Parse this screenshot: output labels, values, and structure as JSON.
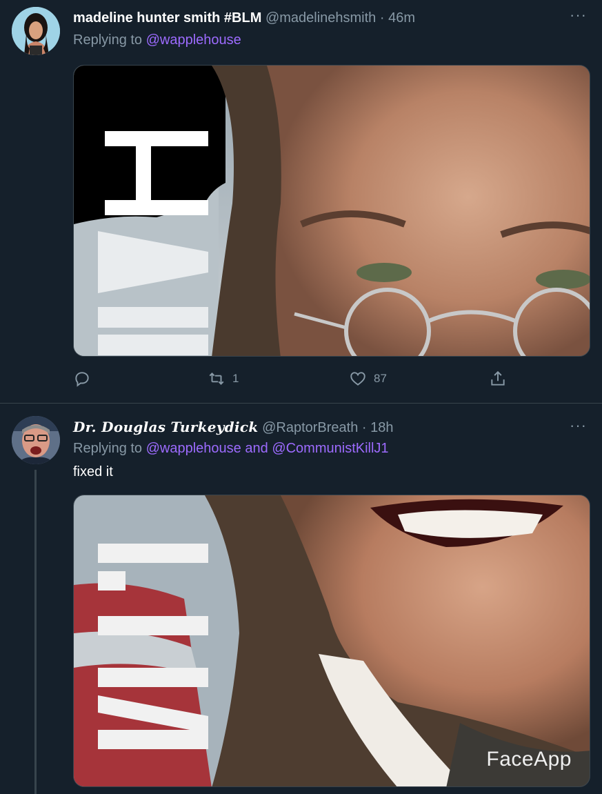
{
  "tweet1": {
    "display_name": "madeline hunter smith #BLM",
    "handle": "@madelinehsmith",
    "separator": "·",
    "time": "46m",
    "more": "···",
    "replying_prefix": "Replying to",
    "replying_to": "@wapplehouse",
    "image_icon": "photo-image",
    "actions": {
      "reply_count": "",
      "retweet_count": "1",
      "like_count": "87"
    }
  },
  "tweet2": {
    "display_name": "Dr. Douglas Turkeydick",
    "handle": "@RaptorBreath",
    "separator": "·",
    "time": "18h",
    "more": "···",
    "replying_prefix": "Replying to",
    "replying_to_1": "@wapplehouse",
    "replying_join": "and",
    "replying_to_2": "@CommunistKillJ1",
    "text": "fixed it",
    "image_icon": "photo-image",
    "watermark": "FaceApp"
  },
  "colors": {
    "background": "#15202b",
    "text": "#ffffff",
    "secondary": "#8899a6",
    "mention": "#9d6bff",
    "border": "#38444d"
  }
}
